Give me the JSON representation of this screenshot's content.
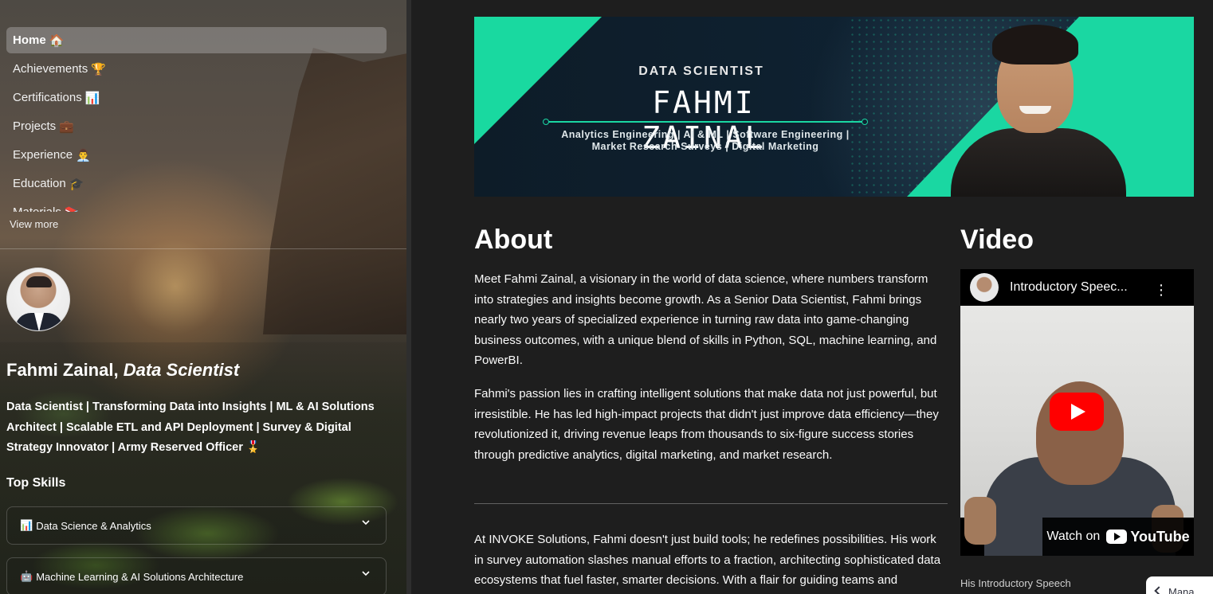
{
  "sidebar": {
    "nav": [
      {
        "label": "Home",
        "emoji": "🏠",
        "active": true
      },
      {
        "label": "Achievements",
        "emoji": "🏆"
      },
      {
        "label": "Certifications",
        "emoji": "📊"
      },
      {
        "label": "Projects",
        "emoji": "💼"
      },
      {
        "label": "Experience",
        "emoji": "👨‍💼"
      },
      {
        "label": "Education",
        "emoji": "🎓"
      },
      {
        "label": "Materials",
        "emoji": "📚"
      }
    ],
    "view_more": "View more",
    "name": "Fahmi Zainal,",
    "role": "Data Scientist",
    "tagline": "Data Scientist | Transforming Data into Insights | ML & AI Solutions Architect | Scalable ETL and API Deployment | Survey & Digital Strategy Innovator | Army Reserved Officer 🎖️",
    "top_skills_heading": "Top Skills",
    "skills": [
      {
        "icon": "📊",
        "label": "Data Science & Analytics"
      },
      {
        "icon": "🤖",
        "label": "Machine Learning & AI Solutions Architecture"
      }
    ]
  },
  "banner": {
    "role": "DATA SCIENTIST",
    "name": "FAHMI ZAINAL",
    "subtitle_line1": "Analytics Engineering | AI & ML | Software Engineering |",
    "subtitle_line2": "Market Research Surveys | Digital Marketing"
  },
  "about": {
    "heading": "About",
    "p1": "Meet Fahmi Zainal, a visionary in the world of data science, where numbers transform into strategies and insights become growth. As a Senior Data Scientist, Fahmi brings nearly two years of specialized experience in turning raw data into game-changing business outcomes, with a unique blend of skills in Python, SQL, machine learning, and PowerBI.",
    "p2": "Fahmi's passion lies in crafting intelligent solutions that make data not just powerful, but irresistible. He has led high-impact projects that didn't just improve data efficiency—they revolutionized it, driving revenue leaps from thousands to six-figure success stories through predictive analytics, digital marketing, and market research.",
    "p3": "At INVOKE Solutions, Fahmi doesn't just build tools; he redefines possibilities. His work in survey automation slashes manual efforts to a fraction, architecting sophisticated data ecosystems that fuel faster, smarter decisions. With a flair for guiding teams and"
  },
  "video": {
    "heading": "Video",
    "title": "Introductory Speec...",
    "watch_on": "Watch on",
    "youtube": "YouTube",
    "caption": "His Introductory Speech"
  },
  "manage": {
    "label": "Mana"
  },
  "colors": {
    "accent": "#1ad7a2",
    "background": "#1e1e1e",
    "youtube_red": "#ff0000"
  }
}
